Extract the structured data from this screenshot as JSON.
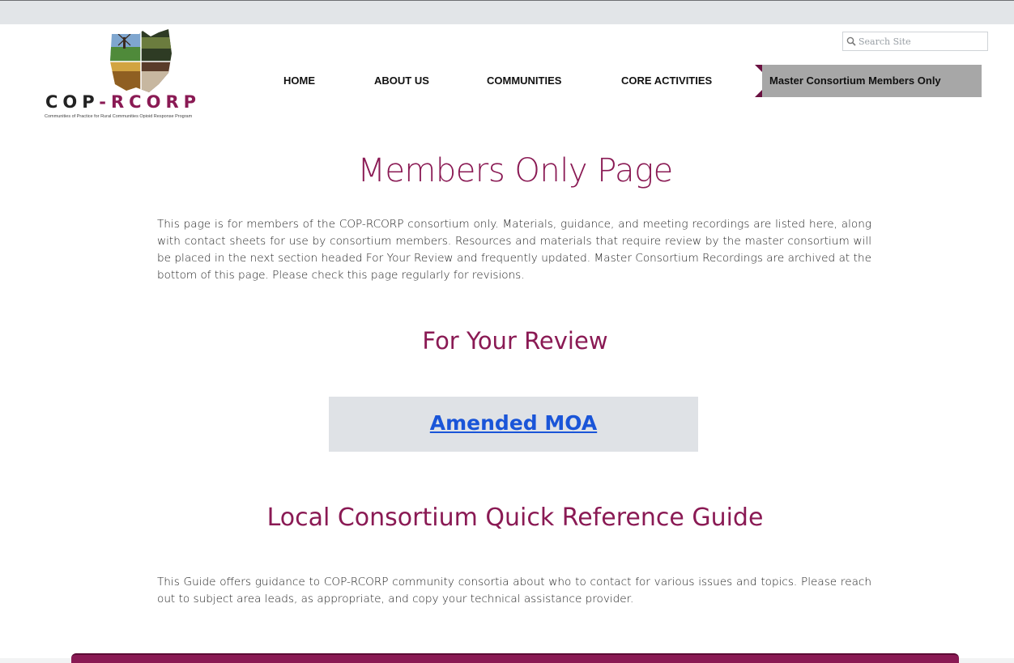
{
  "logo": {
    "wordmark": {
      "part1": "COP",
      "dash": "-",
      "part2": "RCORP"
    },
    "tagline": "Communities of Practice for Rural Communities Opioid Response Program"
  },
  "search": {
    "placeholder": "Search Site",
    "value": "",
    "icon": "magnifier-icon"
  },
  "nav": {
    "home": "HOME",
    "about": "ABOUT US",
    "communities": "COMMUNITIES",
    "core": "CORE ACTIVITIES",
    "members": "Master Consortium Members Only"
  },
  "main": {
    "title": "Members Only Page",
    "intro": "This page is for members of the COP-RCORP consortium only. Materials, guidance, and meeting recordings are listed here, along with contact sheets for use by consortium members.  Resources and materials that require review by the master consortium will be placed in the next section headed For Your Review and frequently updated. Master Consortium Recordings are archived at the bottom of this page. Please check this page regularly for revisions.",
    "review_heading": "For Your Review",
    "review_link": "Amended MOA",
    "guide_heading": "Local Consortium Quick Reference Guide",
    "guide_text": "This Guide offers guidance to COP-RCORP community consortia about who to contact for various issues and topics. Please reach out to subject area leads, as appropriate, and copy your technical assistance provider."
  },
  "colors": {
    "brand": "#8a1a54",
    "link": "#1a55d8",
    "nav_active_bg": "#a7a7a7",
    "box_bg": "#dfe2e6"
  }
}
